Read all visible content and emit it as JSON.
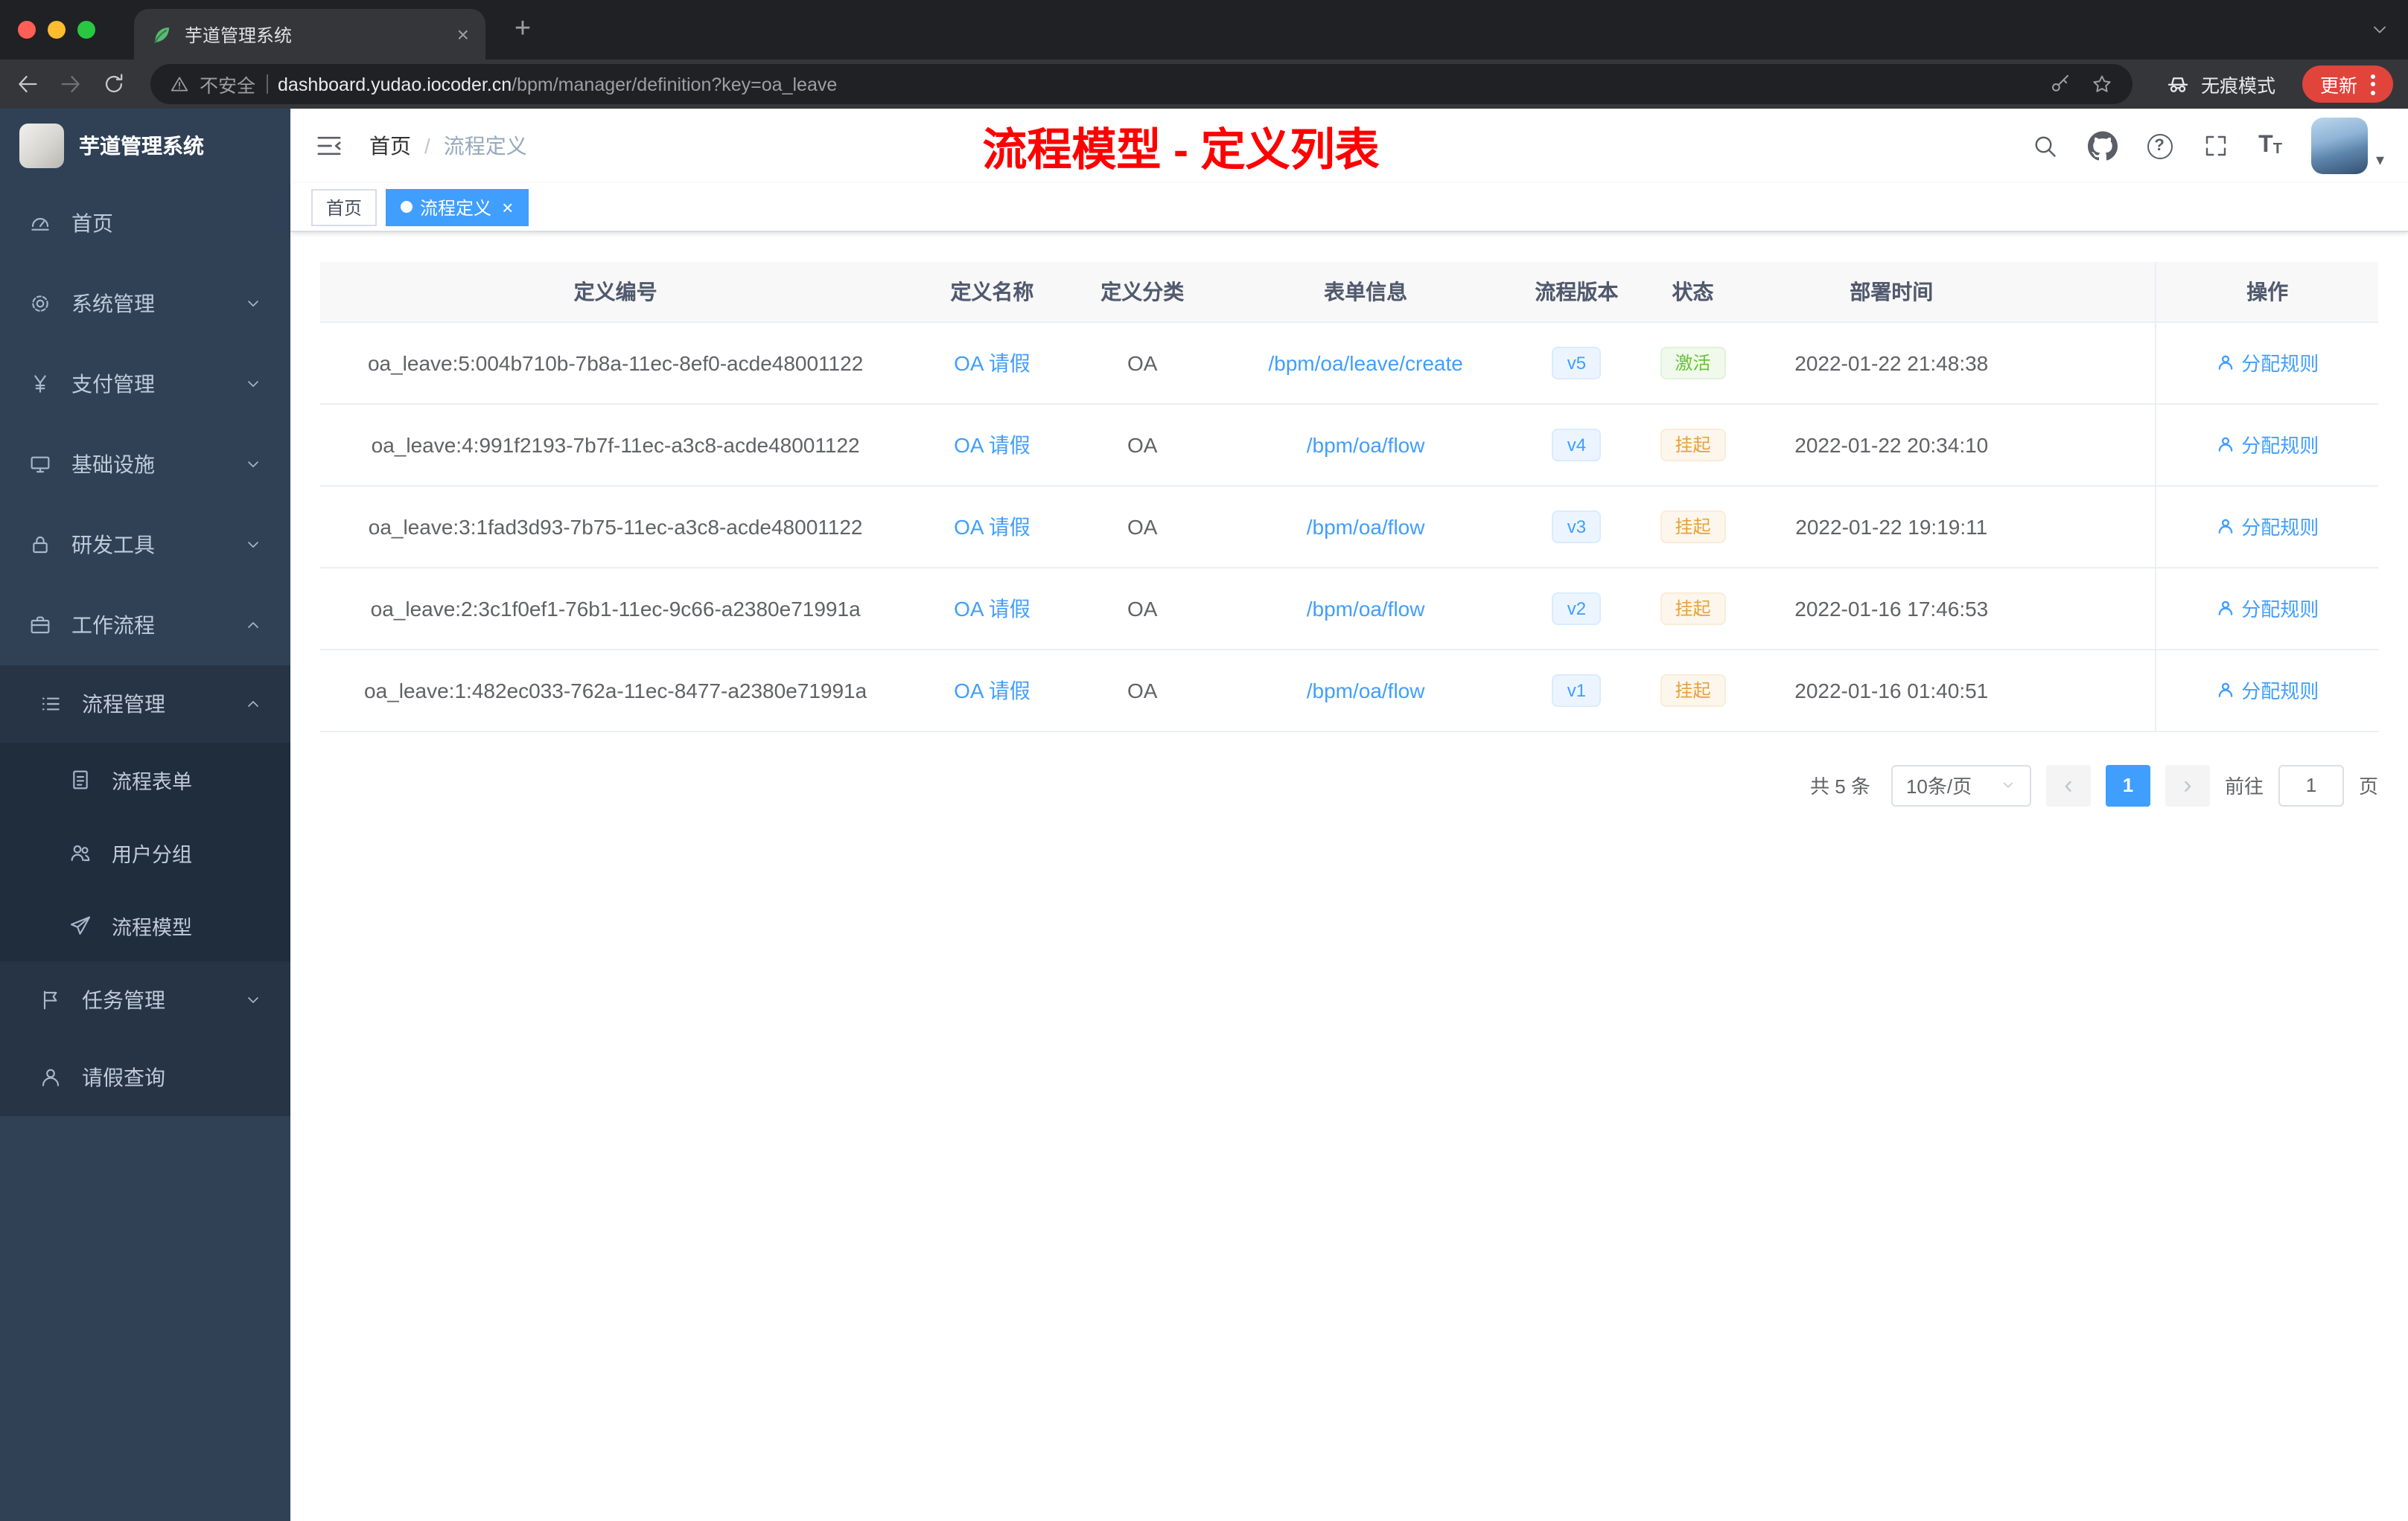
{
  "browser": {
    "tab_title": "芋道管理系统",
    "security_label": "不安全",
    "url_host": "dashboard.yudao.iocoder.cn",
    "url_path": "/bpm/manager/definition?key=oa_leave",
    "incognito_label": "无痕模式",
    "update_label": "更新"
  },
  "sidebar": {
    "logo_title": "芋道管理系统",
    "items": [
      {
        "label": "首页"
      },
      {
        "label": "系统管理"
      },
      {
        "label": "支付管理"
      },
      {
        "label": "基础设施"
      },
      {
        "label": "研发工具"
      },
      {
        "label": "工作流程"
      },
      {
        "label": "流程管理"
      },
      {
        "label": "流程表单"
      },
      {
        "label": "用户分组"
      },
      {
        "label": "流程模型"
      },
      {
        "label": "任务管理"
      },
      {
        "label": "请假查询"
      }
    ]
  },
  "header": {
    "breadcrumb_home": "首页",
    "breadcrumb_sep": "/",
    "breadcrumb_current": "流程定义",
    "annotation": "流程模型 - 定义列表"
  },
  "tags": {
    "home": "首页",
    "active": "流程定义"
  },
  "table": {
    "columns": [
      "定义编号",
      "定义名称",
      "定义分类",
      "表单信息",
      "流程版本",
      "状态",
      "部署时间",
      "操作"
    ],
    "rows": [
      {
        "id": "oa_leave:5:004b710b-7b8a-11ec-8ef0-acde48001122",
        "name": "OA 请假",
        "category": "OA",
        "form": "/bpm/oa/leave/create",
        "version": "v5",
        "status": "激活",
        "deploy_time": "2022-01-22 21:48:38",
        "action": "分配规则"
      },
      {
        "id": "oa_leave:4:991f2193-7b7f-11ec-a3c8-acde48001122",
        "name": "OA 请假",
        "category": "OA",
        "form": "/bpm/oa/flow",
        "version": "v4",
        "status": "挂起",
        "deploy_time": "2022-01-22 20:34:10",
        "action": "分配规则"
      },
      {
        "id": "oa_leave:3:1fad3d93-7b75-11ec-a3c8-acde48001122",
        "name": "OA 请假",
        "category": "OA",
        "form": "/bpm/oa/flow",
        "version": "v3",
        "status": "挂起",
        "deploy_time": "2022-01-22 19:19:11",
        "action": "分配规则"
      },
      {
        "id": "oa_leave:2:3c1f0ef1-76b1-11ec-9c66-a2380e71991a",
        "name": "OA 请假",
        "category": "OA",
        "form": "/bpm/oa/flow",
        "version": "v2",
        "status": "挂起",
        "deploy_time": "2022-01-16 17:46:53",
        "action": "分配规则"
      },
      {
        "id": "oa_leave:1:482ec033-762a-11ec-8477-a2380e71991a",
        "name": "OA 请假",
        "category": "OA",
        "form": "/bpm/oa/flow",
        "version": "v1",
        "status": "挂起",
        "deploy_time": "2022-01-16 01:40:51",
        "action": "分配规则"
      }
    ]
  },
  "pagination": {
    "total": "共 5 条",
    "page_size": "10条/页",
    "current_page": "1",
    "goto_label": "前往",
    "goto_value": "1",
    "page_unit": "页"
  },
  "colors": {
    "primary": "#409eff",
    "success": "#67c23a",
    "warning": "#e6a23c",
    "annotation": "#ff0000",
    "sidebar_bg": "#304156"
  }
}
